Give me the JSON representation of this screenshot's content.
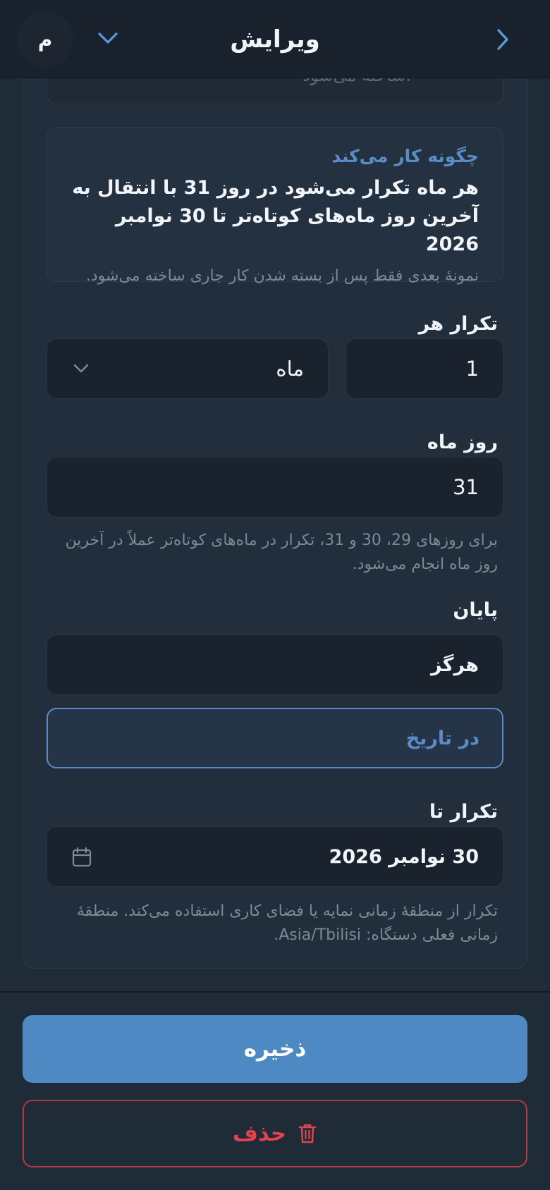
{
  "header": {
    "title": "ویرایش",
    "avatar_initial": "م"
  },
  "info": {
    "heading": "چگونه کار می‌کند",
    "summary": "هر ماه تکرار می‌شود در روز 31 با انتقال به آخرین روز ماه‌های کوتاه‌تر تا 30 نوامبر 2026",
    "note": "نمونهٔ بعدی فقط پس از بسته شدن کار جاری ساخته می‌شود."
  },
  "repeat_every": {
    "label": "تکرار هر",
    "interval_value": "1",
    "unit_value": "ماه"
  },
  "day_of_month": {
    "label": "روز ماه",
    "value": "31",
    "helper": "برای روزهای 29، 30 و 31، تکرار در ماه‌های کوتاه‌تر عملاً در آخرین روز ماه انجام می‌شود."
  },
  "end": {
    "label": "پایان",
    "option_never": "هرگز",
    "option_on_date": "در تاریخ"
  },
  "repeat_until": {
    "label": "تکرار تا",
    "value": "30 نوامبر 2026",
    "helper": "تکرار از منطقهٔ زمانی نمایه یا فضای کاری استفاده می‌کند. منطقهٔ زمانی فعلی دستگاه: Asia/Tbilisi."
  },
  "actions": {
    "save_label": "ذخیره",
    "delete_label": "حذف"
  },
  "colors": {
    "accent": "#4f89c4",
    "danger": "#e2414e",
    "background": "#202b38"
  }
}
